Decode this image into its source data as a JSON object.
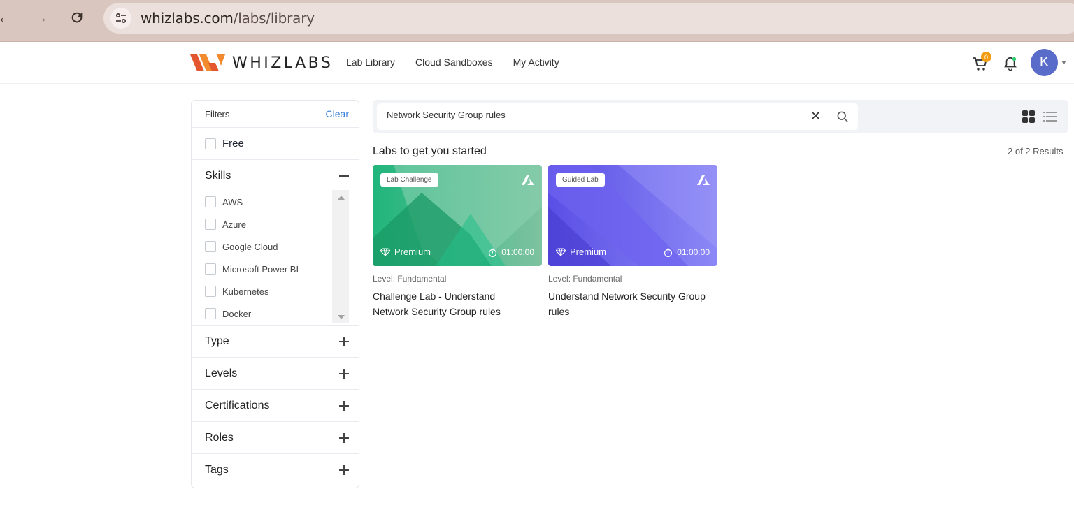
{
  "browser": {
    "url_domain": "whizlabs.com",
    "url_path": "/labs/library"
  },
  "header": {
    "logo_text": "WHIZLABS",
    "nav": [
      "Lab Library",
      "Cloud Sandboxes",
      "My Activity"
    ],
    "cart_count": "0",
    "avatar_initial": "K"
  },
  "filters": {
    "title": "Filters",
    "clear_label": "Clear",
    "free_label": "Free",
    "skills": {
      "title": "Skills",
      "items": [
        "AWS",
        "Azure",
        "Google Cloud",
        "Microsoft Power BI",
        "Kubernetes",
        "Docker"
      ]
    },
    "sections": [
      "Type",
      "Levels",
      "Certifications",
      "Roles",
      "Tags"
    ]
  },
  "search": {
    "value": "Network Security Group rules"
  },
  "main": {
    "section_title": "Labs to get you started",
    "results_text": "2 of 2 Results"
  },
  "cards": [
    {
      "chip": "Lab Challenge",
      "premium": "Premium",
      "duration": "01:00:00",
      "level": "Level: Fundamental",
      "title": "Challenge Lab - Understand Network Security Group rules",
      "color_a": "#1fb27a",
      "color_b": "#7fc3a0"
    },
    {
      "chip": "Guided Lab",
      "premium": "Premium",
      "duration": "01:00:00",
      "level": "Level: Fundamental",
      "title": "Understand Network Security Group rules",
      "color_a": "#5b4fe6",
      "color_b": "#8a86f5"
    }
  ],
  "colors": {
    "accent_link": "#3b82d9",
    "avatar": "#5a6cc9",
    "cart_badge": "#f39c12",
    "browser_bar": "#d9c6bf"
  },
  "icons": [
    "back-arrow-icon",
    "forward-arrow-icon",
    "reload-icon",
    "site-settings-icon",
    "cart-icon",
    "bell-icon",
    "search-icon",
    "close-icon",
    "grid-view-icon",
    "list-view-icon",
    "diamond-icon",
    "timer-icon",
    "azure-icon"
  ]
}
